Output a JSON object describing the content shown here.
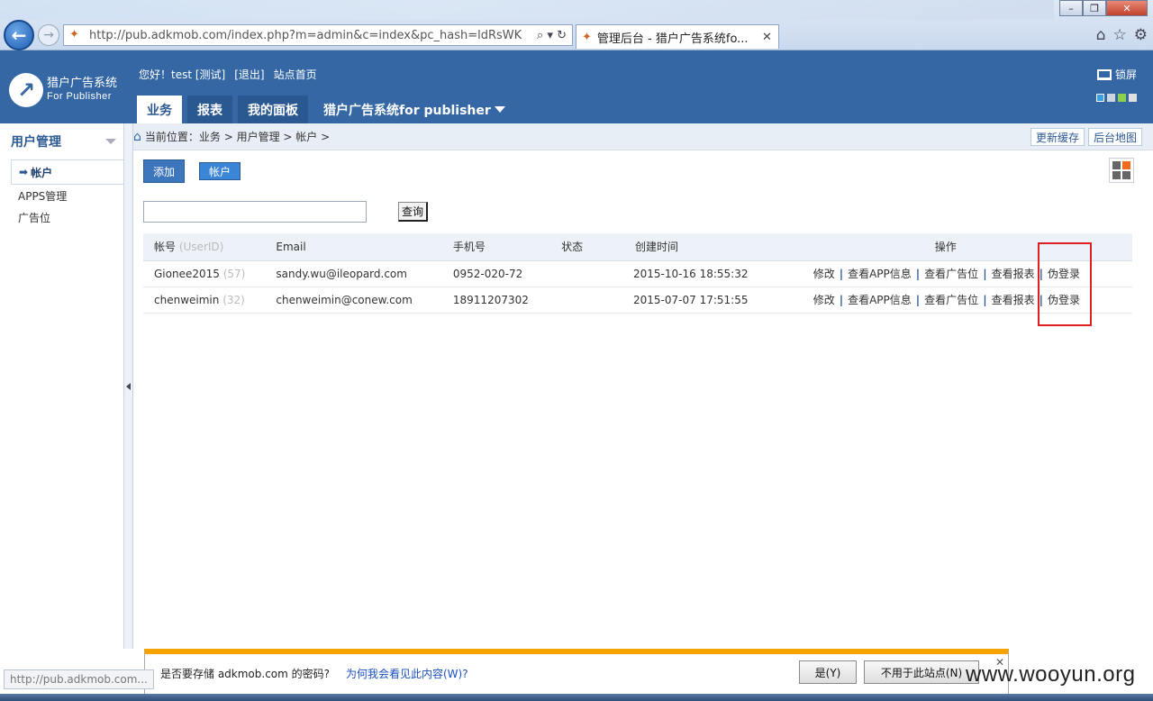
{
  "browser": {
    "url": "http://pub.adkmob.com/index.php?m=admin&c=index&pc_hash=ldRsWK",
    "tab_title": "管理后台 - 猎户广告系统fo...",
    "status_url": "http://pub.adkmob.com..."
  },
  "app": {
    "logo_line1": "猎户广告系统",
    "logo_line2": "For  Publisher",
    "greeting": "您好！test [测试]",
    "logout": "[退出]",
    "site_home": "站点首页",
    "lock_screen": "锁屏",
    "tabs": [
      "业务",
      "报表",
      "我的面板",
      "猎户广告系统for publisher"
    ]
  },
  "sidebar": {
    "section_title": "用户管理",
    "items": [
      "帐户",
      "APPS管理",
      "广告位"
    ]
  },
  "breadcrumb": {
    "text": "当前位置：业务 > 用户管理 > 帐户 >",
    "refresh_cache": "更新缓存",
    "backend_map": "后台地图"
  },
  "actions": {
    "add": "添加",
    "account": "帐户"
  },
  "search": {
    "value": "",
    "query_button": "查询"
  },
  "table": {
    "headers": {
      "account": "帐号",
      "account_hint": "(UserID)",
      "email": "Email",
      "phone": "手机号",
      "status": "状态",
      "created": "创建时间",
      "ops": "操作"
    },
    "rows": [
      {
        "account": "Gionee2015",
        "uid": "(57)",
        "email": "sandy.wu@ileopard.com",
        "phone": "0952-020-72",
        "status": "",
        "created": "2015-10-16 18:55:32"
      },
      {
        "account": "chenweimin",
        "uid": "(32)",
        "email": "chenweimin@conew.com",
        "phone": "18911207302",
        "status": "",
        "created": "2015-07-07 17:51:55"
      }
    ],
    "ops": [
      "修改",
      "查看APP信息",
      "查看广告位",
      "查看报表",
      "伪登录"
    ]
  },
  "password_bar": {
    "question": "是否要存储 adkmob.com 的密码?",
    "why_link": "为何我会看见此内容(W)?",
    "yes": "是(Y)",
    "no": "不用于此站点(N)"
  },
  "watermark": "www.wooyun.org",
  "colors": {
    "header_blue": "#3467a4",
    "highlight_red": "#e02020",
    "notify_orange": "#f5a300"
  }
}
